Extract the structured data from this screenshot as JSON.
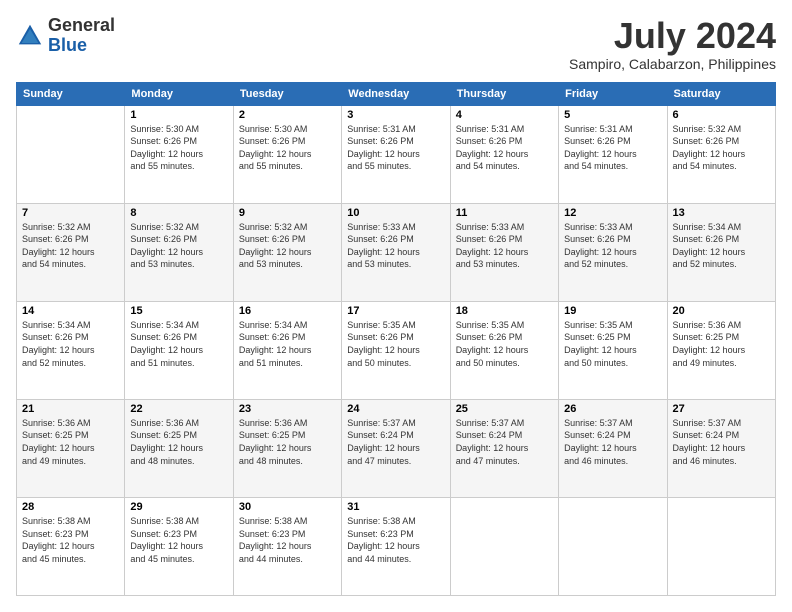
{
  "logo": {
    "general": "General",
    "blue": "Blue"
  },
  "header": {
    "month_year": "July 2024",
    "location": "Sampiro, Calabarzon, Philippines"
  },
  "days_of_week": [
    "Sunday",
    "Monday",
    "Tuesday",
    "Wednesday",
    "Thursday",
    "Friday",
    "Saturday"
  ],
  "weeks": [
    [
      {
        "day": "",
        "info": ""
      },
      {
        "day": "1",
        "info": "Sunrise: 5:30 AM\nSunset: 6:26 PM\nDaylight: 12 hours\nand 55 minutes."
      },
      {
        "day": "2",
        "info": "Sunrise: 5:30 AM\nSunset: 6:26 PM\nDaylight: 12 hours\nand 55 minutes."
      },
      {
        "day": "3",
        "info": "Sunrise: 5:31 AM\nSunset: 6:26 PM\nDaylight: 12 hours\nand 55 minutes."
      },
      {
        "day": "4",
        "info": "Sunrise: 5:31 AM\nSunset: 6:26 PM\nDaylight: 12 hours\nand 54 minutes."
      },
      {
        "day": "5",
        "info": "Sunrise: 5:31 AM\nSunset: 6:26 PM\nDaylight: 12 hours\nand 54 minutes."
      },
      {
        "day": "6",
        "info": "Sunrise: 5:32 AM\nSunset: 6:26 PM\nDaylight: 12 hours\nand 54 minutes."
      }
    ],
    [
      {
        "day": "7",
        "info": "Sunrise: 5:32 AM\nSunset: 6:26 PM\nDaylight: 12 hours\nand 54 minutes."
      },
      {
        "day": "8",
        "info": "Sunrise: 5:32 AM\nSunset: 6:26 PM\nDaylight: 12 hours\nand 53 minutes."
      },
      {
        "day": "9",
        "info": "Sunrise: 5:32 AM\nSunset: 6:26 PM\nDaylight: 12 hours\nand 53 minutes."
      },
      {
        "day": "10",
        "info": "Sunrise: 5:33 AM\nSunset: 6:26 PM\nDaylight: 12 hours\nand 53 minutes."
      },
      {
        "day": "11",
        "info": "Sunrise: 5:33 AM\nSunset: 6:26 PM\nDaylight: 12 hours\nand 53 minutes."
      },
      {
        "day": "12",
        "info": "Sunrise: 5:33 AM\nSunset: 6:26 PM\nDaylight: 12 hours\nand 52 minutes."
      },
      {
        "day": "13",
        "info": "Sunrise: 5:34 AM\nSunset: 6:26 PM\nDaylight: 12 hours\nand 52 minutes."
      }
    ],
    [
      {
        "day": "14",
        "info": "Sunrise: 5:34 AM\nSunset: 6:26 PM\nDaylight: 12 hours\nand 52 minutes."
      },
      {
        "day": "15",
        "info": "Sunrise: 5:34 AM\nSunset: 6:26 PM\nDaylight: 12 hours\nand 51 minutes."
      },
      {
        "day": "16",
        "info": "Sunrise: 5:34 AM\nSunset: 6:26 PM\nDaylight: 12 hours\nand 51 minutes."
      },
      {
        "day": "17",
        "info": "Sunrise: 5:35 AM\nSunset: 6:26 PM\nDaylight: 12 hours\nand 50 minutes."
      },
      {
        "day": "18",
        "info": "Sunrise: 5:35 AM\nSunset: 6:26 PM\nDaylight: 12 hours\nand 50 minutes."
      },
      {
        "day": "19",
        "info": "Sunrise: 5:35 AM\nSunset: 6:25 PM\nDaylight: 12 hours\nand 50 minutes."
      },
      {
        "day": "20",
        "info": "Sunrise: 5:36 AM\nSunset: 6:25 PM\nDaylight: 12 hours\nand 49 minutes."
      }
    ],
    [
      {
        "day": "21",
        "info": "Sunrise: 5:36 AM\nSunset: 6:25 PM\nDaylight: 12 hours\nand 49 minutes."
      },
      {
        "day": "22",
        "info": "Sunrise: 5:36 AM\nSunset: 6:25 PM\nDaylight: 12 hours\nand 48 minutes."
      },
      {
        "day": "23",
        "info": "Sunrise: 5:36 AM\nSunset: 6:25 PM\nDaylight: 12 hours\nand 48 minutes."
      },
      {
        "day": "24",
        "info": "Sunrise: 5:37 AM\nSunset: 6:24 PM\nDaylight: 12 hours\nand 47 minutes."
      },
      {
        "day": "25",
        "info": "Sunrise: 5:37 AM\nSunset: 6:24 PM\nDaylight: 12 hours\nand 47 minutes."
      },
      {
        "day": "26",
        "info": "Sunrise: 5:37 AM\nSunset: 6:24 PM\nDaylight: 12 hours\nand 46 minutes."
      },
      {
        "day": "27",
        "info": "Sunrise: 5:37 AM\nSunset: 6:24 PM\nDaylight: 12 hours\nand 46 minutes."
      }
    ],
    [
      {
        "day": "28",
        "info": "Sunrise: 5:38 AM\nSunset: 6:23 PM\nDaylight: 12 hours\nand 45 minutes."
      },
      {
        "day": "29",
        "info": "Sunrise: 5:38 AM\nSunset: 6:23 PM\nDaylight: 12 hours\nand 45 minutes."
      },
      {
        "day": "30",
        "info": "Sunrise: 5:38 AM\nSunset: 6:23 PM\nDaylight: 12 hours\nand 44 minutes."
      },
      {
        "day": "31",
        "info": "Sunrise: 5:38 AM\nSunset: 6:23 PM\nDaylight: 12 hours\nand 44 minutes."
      },
      {
        "day": "",
        "info": ""
      },
      {
        "day": "",
        "info": ""
      },
      {
        "day": "",
        "info": ""
      }
    ]
  ]
}
